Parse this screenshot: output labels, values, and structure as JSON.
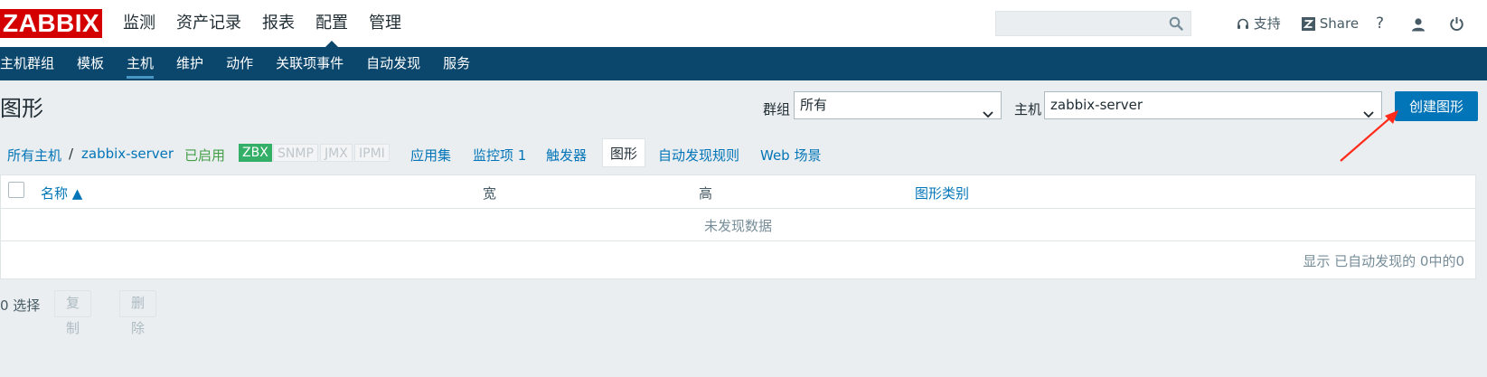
{
  "logo": "ZABBIX",
  "main_menu": [
    "监测",
    "资产记录",
    "报表",
    "配置",
    "管理"
  ],
  "search": {
    "value": "",
    "placeholder": ""
  },
  "topbar": {
    "support": "支持",
    "share": "Share",
    "help": "?"
  },
  "sub_menu": [
    "主机群组",
    "模板",
    "主机",
    "维护",
    "动作",
    "关联项事件",
    "自动发现",
    "服务"
  ],
  "page_title": "图形",
  "filters": {
    "group_label": "群组",
    "group_value": "所有",
    "host_label": "主机",
    "host_value": "zabbix-server"
  },
  "create_button": "创建图形",
  "breadcrumb": {
    "all_hosts": "所有主机",
    "separator": "/",
    "host": "zabbix-server",
    "status": "已启用",
    "availability": [
      "ZBX",
      "SNMP",
      "JMX",
      "IPMI"
    ],
    "tabs": [
      "应用集",
      "监控项 1",
      "触发器",
      "图形",
      "自动发现规则",
      "Web 场景"
    ]
  },
  "table": {
    "headers": [
      "名称 ▲",
      "宽",
      "高",
      "图形类别"
    ],
    "empty": "未发现数据",
    "paging": "显示 已自动发现的 0中的0"
  },
  "footer": {
    "selected": "0 选择",
    "copy": "复制",
    "delete": "删除"
  },
  "colors": {
    "brand": "#d40000",
    "nav": "#0b476d",
    "accent": "#0275b8",
    "enabled": "#429e47",
    "zbx": "#34af67",
    "annotation_arrow": "#ff2a1a"
  }
}
